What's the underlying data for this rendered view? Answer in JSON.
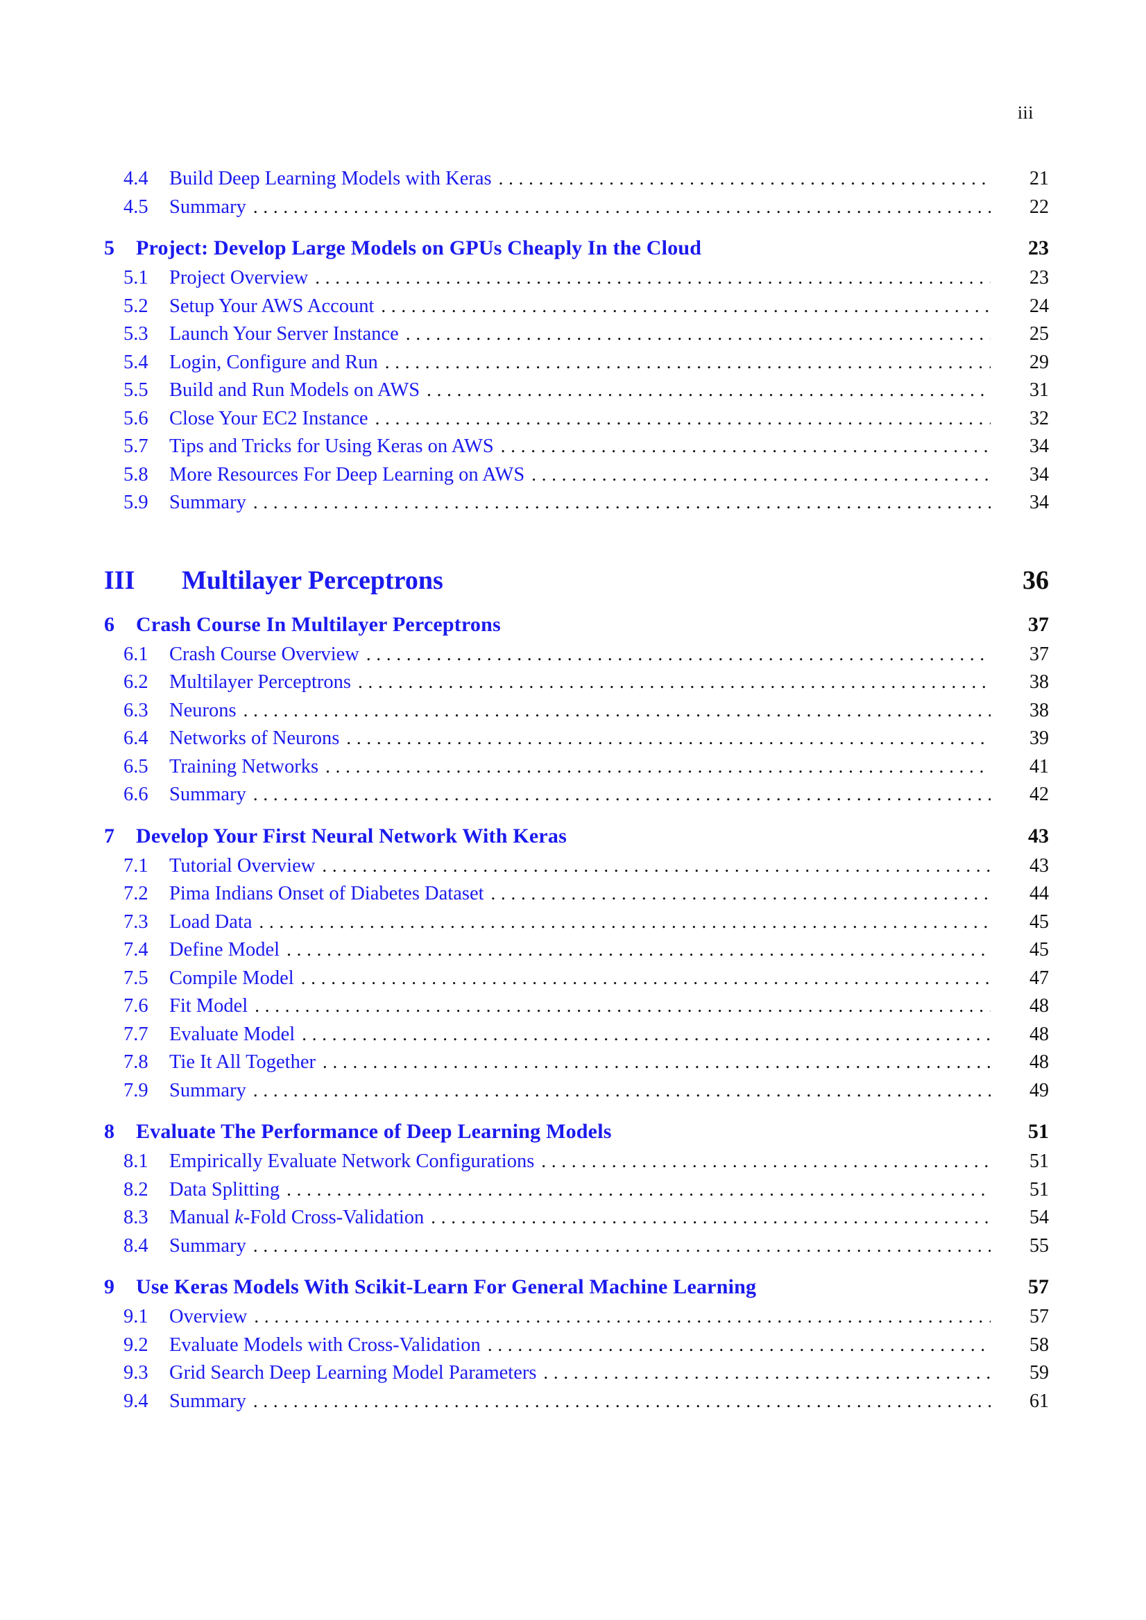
{
  "page": {
    "folio": "iii"
  },
  "toc": {
    "entries": [
      {
        "kind": "section",
        "number": "4.4",
        "title": "Build Deep Learning Models with Keras",
        "page": "21"
      },
      {
        "kind": "section",
        "number": "4.5",
        "title": "Summary",
        "page": "22"
      },
      {
        "kind": "chapter",
        "number": "5",
        "title": "Project: Develop Large Models on GPUs Cheaply In the Cloud",
        "page": "23"
      },
      {
        "kind": "section",
        "number": "5.1",
        "title": "Project Overview",
        "page": "23"
      },
      {
        "kind": "section",
        "number": "5.2",
        "title": "Setup Your AWS Account",
        "page": "24"
      },
      {
        "kind": "section",
        "number": "5.3",
        "title": "Launch Your Server Instance",
        "page": "25"
      },
      {
        "kind": "section",
        "number": "5.4",
        "title": "Login, Configure and Run",
        "page": "29"
      },
      {
        "kind": "section",
        "number": "5.5",
        "title": "Build and Run Models on AWS",
        "page": "31"
      },
      {
        "kind": "section",
        "number": "5.6",
        "title": "Close Your EC2 Instance",
        "page": "32"
      },
      {
        "kind": "section",
        "number": "5.7",
        "title": "Tips and Tricks for Using Keras on AWS",
        "page": "34"
      },
      {
        "kind": "section",
        "number": "5.8",
        "title": "More Resources For Deep Learning on AWS",
        "page": "34"
      },
      {
        "kind": "section",
        "number": "5.9",
        "title": "Summary",
        "page": "34"
      },
      {
        "kind": "part",
        "number": "III",
        "title": "Multilayer Perceptrons",
        "page": "36"
      },
      {
        "kind": "chapter",
        "number": "6",
        "title": "Crash Course In Multilayer Perceptrons",
        "page": "37"
      },
      {
        "kind": "section",
        "number": "6.1",
        "title": "Crash Course Overview",
        "page": "37"
      },
      {
        "kind": "section",
        "number": "6.2",
        "title": "Multilayer Perceptrons",
        "page": "38"
      },
      {
        "kind": "section",
        "number": "6.3",
        "title": "Neurons",
        "page": "38"
      },
      {
        "kind": "section",
        "number": "6.4",
        "title": "Networks of Neurons",
        "page": "39"
      },
      {
        "kind": "section",
        "number": "6.5",
        "title": "Training Networks",
        "page": "41"
      },
      {
        "kind": "section",
        "number": "6.6",
        "title": "Summary",
        "page": "42"
      },
      {
        "kind": "chapter",
        "number": "7",
        "title": "Develop Your First Neural Network With Keras",
        "page": "43"
      },
      {
        "kind": "section",
        "number": "7.1",
        "title": "Tutorial Overview",
        "page": "43"
      },
      {
        "kind": "section",
        "number": "7.2",
        "title": "Pima Indians Onset of Diabetes Dataset",
        "page": "44"
      },
      {
        "kind": "section",
        "number": "7.3",
        "title": "Load Data",
        "page": "45"
      },
      {
        "kind": "section",
        "number": "7.4",
        "title": "Define Model",
        "page": "45"
      },
      {
        "kind": "section",
        "number": "7.5",
        "title": "Compile Model",
        "page": "47"
      },
      {
        "kind": "section",
        "number": "7.6",
        "title": "Fit Model",
        "page": "48"
      },
      {
        "kind": "section",
        "number": "7.7",
        "title": "Evaluate Model",
        "page": "48"
      },
      {
        "kind": "section",
        "number": "7.8",
        "title": "Tie It All Together",
        "page": "48"
      },
      {
        "kind": "section",
        "number": "7.9",
        "title": "Summary",
        "page": "49"
      },
      {
        "kind": "chapter",
        "number": "8",
        "title": "Evaluate The Performance of Deep Learning Models",
        "page": "51"
      },
      {
        "kind": "section",
        "number": "8.1",
        "title": "Empirically Evaluate Network Configurations",
        "page": "51"
      },
      {
        "kind": "section",
        "number": "8.2",
        "title": "Data Splitting",
        "page": "51"
      },
      {
        "kind": "section",
        "number": "8.3",
        "title": "Manual k-Fold Cross-Validation",
        "title_italic_token": "k",
        "page": "54"
      },
      {
        "kind": "section",
        "number": "8.4",
        "title": "Summary",
        "page": "55"
      },
      {
        "kind": "chapter",
        "number": "9",
        "title": "Use Keras Models With Scikit-Learn For General Machine Learning",
        "page": "57"
      },
      {
        "kind": "section",
        "number": "9.1",
        "title": "Overview",
        "page": "57"
      },
      {
        "kind": "section",
        "number": "9.2",
        "title": "Evaluate Models with Cross-Validation",
        "page": "58"
      },
      {
        "kind": "section",
        "number": "9.3",
        "title": "Grid Search Deep Learning Model Parameters",
        "page": "59"
      },
      {
        "kind": "section",
        "number": "9.4",
        "title": "Summary",
        "page": "61"
      }
    ]
  },
  "colors": {
    "link_blue": "#1a1aee",
    "page_number": "#0e0e0e",
    "background": "#ffffff"
  }
}
